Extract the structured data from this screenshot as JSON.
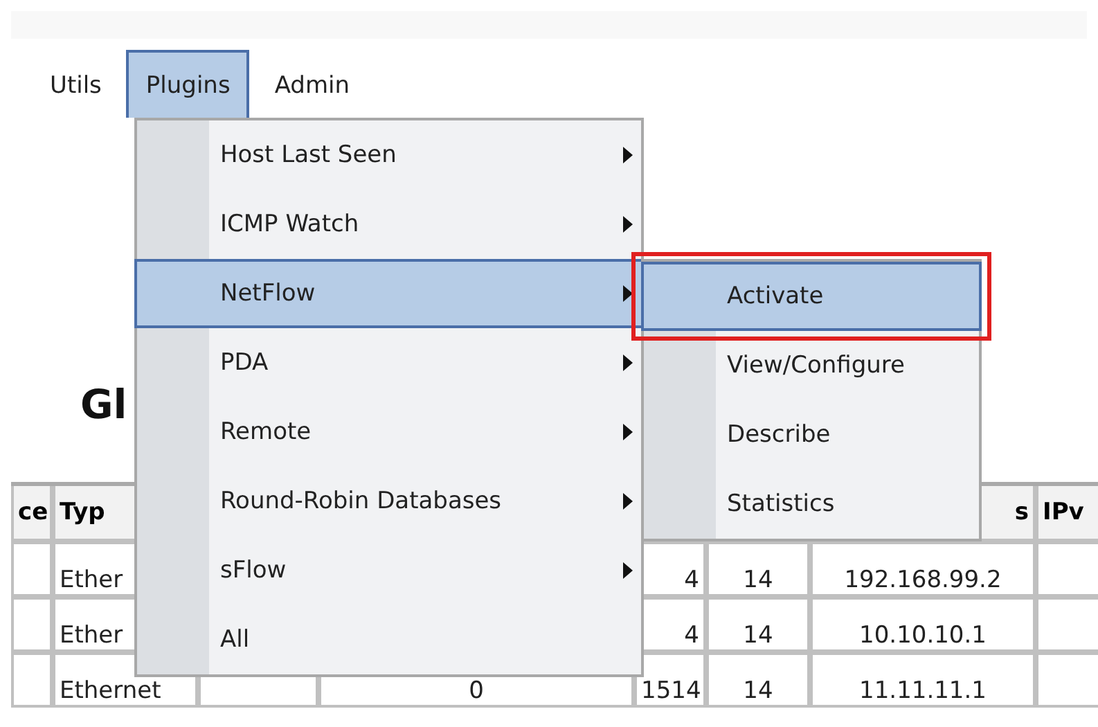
{
  "menubar": [
    {
      "label": "Utils",
      "selected": false
    },
    {
      "label": "Plugins",
      "selected": true
    },
    {
      "label": "Admin",
      "selected": false
    }
  ],
  "menu": {
    "items": [
      {
        "label": "Host Last Seen",
        "has_submenu": true,
        "selected": false
      },
      {
        "label": "ICMP Watch",
        "has_submenu": true,
        "selected": false
      },
      {
        "label": "NetFlow",
        "has_submenu": true,
        "selected": true
      },
      {
        "label": "PDA",
        "has_submenu": true,
        "selected": false
      },
      {
        "label": "Remote",
        "has_submenu": true,
        "selected": false
      },
      {
        "label": "Round-Robin Databases",
        "has_submenu": true,
        "selected": false
      },
      {
        "label": "sFlow",
        "has_submenu": true,
        "selected": false
      },
      {
        "label": "All",
        "has_submenu": false,
        "selected": false
      }
    ]
  },
  "submenu": {
    "items": [
      {
        "label": "Activate",
        "selected": true,
        "highlighted": true
      },
      {
        "label": "View/Configure",
        "selected": false,
        "highlighted": false
      },
      {
        "label": "Describe",
        "selected": false,
        "highlighted": false
      },
      {
        "label": "Statistics",
        "selected": false,
        "highlighted": false
      }
    ]
  },
  "heading": "Gl",
  "table": {
    "columns": [
      {
        "label": "ce"
      },
      {
        "label": "Typ"
      },
      {},
      {},
      {},
      {},
      {
        "label": "s"
      },
      {
        "label": "IPv"
      }
    ],
    "rows": [
      [
        null,
        "Ether",
        null,
        null,
        "4",
        "14",
        "192.168.99.2",
        null
      ],
      [
        null,
        "Ether",
        null,
        null,
        "4",
        "14",
        "10.10.10.1",
        null
      ],
      [
        null,
        "Ethernet",
        null,
        "0",
        "1514",
        "14",
        "11.11.11.1",
        null
      ]
    ]
  }
}
